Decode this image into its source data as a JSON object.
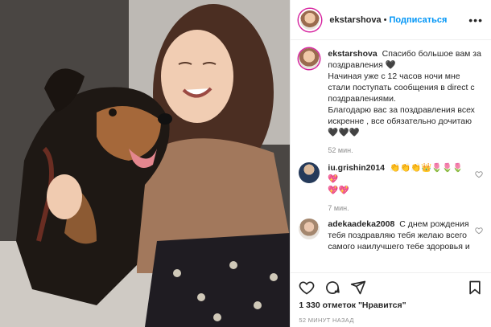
{
  "header": {
    "username": "ekstarshova",
    "dot": "•",
    "follow_label": "Подписаться",
    "more": "•••"
  },
  "caption": {
    "username": "ekstarshova",
    "text": "Спасибо большое вам за поздравления 🖤\nНачиная уже с 12 часов ночи мне стали поступать сообщения в direct с поздравлениями.\nБлагодарю вас за поздравления всех искренне , все обязательно дочитаю\n🖤🖤🖤",
    "time": "52 мин."
  },
  "comments": [
    {
      "username": "iu.grishin2014",
      "text": "👏👏👏👑🌷🌷🌷💖\n💖💖",
      "time": "7 мин."
    },
    {
      "username": "adekaadeka2008",
      "text": "С днем рождения тебя поздравляю тебя желаю всего самого наилучшего тебе здоровья и",
      "time": ""
    }
  ],
  "footer": {
    "likes": "1 330 отметок \"Нравится\"",
    "post_time": "52 МИНУТ НАЗАД"
  },
  "icons": {
    "like": "heart-icon",
    "comment": "comment-icon",
    "share": "share-icon",
    "save": "bookmark-icon"
  },
  "colors": {
    "accent": "#0095f6",
    "muted": "#8e8e8e"
  }
}
